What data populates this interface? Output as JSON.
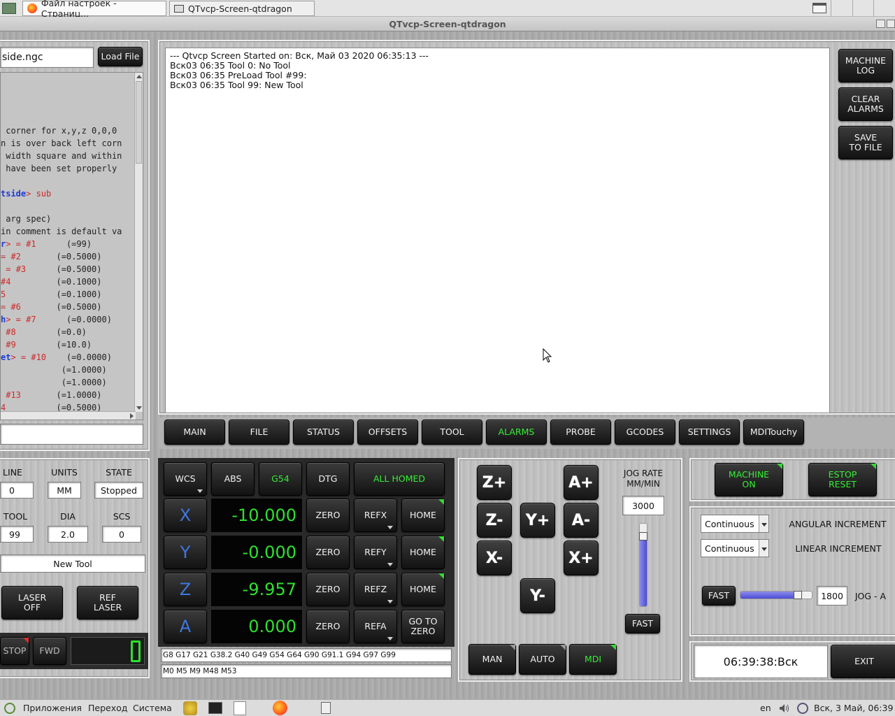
{
  "os": {
    "tabs": [
      {
        "label": "Файл настроек - Страниц..."
      },
      {
        "label": "QTvcp-Screen-qtdragon"
      }
    ],
    "window_title": "QTvcp-Screen-qtdragon"
  },
  "file_panel": {
    "filename": "side.ngc",
    "load_button": "Load File",
    "code_lines": [
      {
        "plain": ""
      },
      {
        "plain": ""
      },
      {
        "plain": ""
      },
      {
        "plain": ""
      },
      {
        "plain": " corner for x,y,z 0,0,0"
      },
      {
        "plain": "n is over back left corn"
      },
      {
        "plain": " width square and within"
      },
      {
        "plain": " have been set properly"
      },
      {
        "plain": ""
      },
      {
        "kw": "tside",
        "rest": "> sub",
        "restkw": "sub"
      },
      {
        "plain": ""
      },
      {
        "plain": " arg spec)"
      },
      {
        "plain": "in comment is default va"
      },
      {
        "kw": "r",
        "eq": "> = ",
        "red": "#1",
        "val": "      (=99)"
      },
      {
        "eq": "= ",
        "red": "#2",
        "val": "       (=0.5000)"
      },
      {
        "eq": " = ",
        "red": "#3",
        "val": "      (=0.5000)"
      },
      {
        "red": "#4",
        "val": "         (=0.1000)"
      },
      {
        "red": "5",
        "val": "          (=0.1000)"
      },
      {
        "eq": "= ",
        "red": "#6",
        "val": "       (=0.5000)"
      },
      {
        "kw": "h",
        "eq": "> = ",
        "red": "#7",
        "val": "      (=0.0000)"
      },
      {
        "eq": " ",
        "red": "#8",
        "val": "        (=0.0)"
      },
      {
        "eq": " ",
        "red": "#9",
        "val": "        (=10.0)"
      },
      {
        "kw": "et",
        "eq": "> = ",
        "red": "#10",
        "val": "    (=0.0000)"
      },
      {
        "val": "            (=1.0000)"
      },
      {
        "val": "            (=1.0000)"
      },
      {
        "eq": " ",
        "red": "#13",
        "val": "       (=1.0000)"
      },
      {
        "red": "4",
        "val": "          (=0.5000)"
      }
    ]
  },
  "log": {
    "lines": [
      "--- Qtvcp Screen Started on: Вск, Май 03 2020 06:35:13 ---",
      "Вск03 06:35 Tool 0: No Tool",
      "Вск03 06:35 PreLoad Tool #99:",
      "Вск03 06:35 Tool 99: New Tool"
    ],
    "buttons": [
      "MACHINE\nLOG",
      "CLEAR\nALARMS",
      "SAVE\nTO FILE"
    ]
  },
  "tabs": [
    {
      "label": "MAIN",
      "active": false
    },
    {
      "label": "FILE",
      "active": false
    },
    {
      "label": "STATUS",
      "active": false
    },
    {
      "label": "OFFSETS",
      "active": false
    },
    {
      "label": "TOOL",
      "active": false
    },
    {
      "label": "ALARMS",
      "active": true
    },
    {
      "label": "PROBE",
      "active": false
    },
    {
      "label": "GCODES",
      "active": false
    },
    {
      "label": "SETTINGS",
      "active": false
    },
    {
      "label": "MDITouchy",
      "active": false
    }
  ],
  "status": {
    "line_label": "LINE",
    "line_value": "0",
    "units_label": "UNITS",
    "units_value": "MM",
    "state_label": "STATE",
    "state_value": "Stopped",
    "tool_label": "TOOL",
    "tool_value": "99",
    "dia_label": "DIA",
    "dia_value": "2.0",
    "scs_label": "SCS",
    "scs_value": "0",
    "tool_description": "New Tool",
    "laser_off": "LASER\nOFF",
    "ref_laser": "REF\nLASER",
    "stop": "STOP",
    "fwd": "FWD"
  },
  "dro": {
    "wcs": "WCS",
    "abs": "ABS",
    "g54": "G54",
    "dtg": "DTG",
    "all_homed": "ALL HOMED",
    "axes": [
      {
        "name": "X",
        "value": "-10.000",
        "ref": "REFX",
        "home": "HOME"
      },
      {
        "name": "Y",
        "value": "-0.000",
        "ref": "REFY",
        "home": "HOME"
      },
      {
        "name": "Z",
        "value": "-9.957",
        "ref": "REFZ",
        "home": "HOME"
      },
      {
        "name": "A",
        "value": "0.000",
        "ref": "REFA",
        "home": "GO TO\nZERO"
      }
    ],
    "zero": "ZERO",
    "gcodes": "G8 G17 G21 G38.2 G40 G49 G54 G64 G90 G91.1 G94 G97 G99",
    "mcodes": "M0 M5 M9 M48 M53"
  },
  "jog": {
    "rate_label": "JOG RATE\nMM/MIN",
    "rate_value": "3000",
    "rate_level": 0.85,
    "fast": "FAST",
    "modes": [
      "MAN",
      "AUTO",
      "MDI"
    ],
    "keys": {
      "zp": "Z+",
      "zm": "Z-",
      "ap": "A+",
      "am": "A-",
      "yp": "Y+",
      "ym": "Y-",
      "xm": "X-",
      "xp": "X+"
    }
  },
  "right": {
    "machine_on": "MACHINE\nON",
    "estop_reset": "ESTOP\nRESET",
    "angular_select": "Continuous",
    "angular_label": "ANGULAR INCREMENT",
    "linear_select": "Continuous",
    "linear_label": "LINEAR INCREMENT",
    "fast": "FAST",
    "jog_a_value": "1800",
    "jog_a_label": "JOG - A",
    "jog_a_level": 0.8,
    "clock": "06:39:38:Вск",
    "exit": "EXIT"
  },
  "taskbar": {
    "apps": "Приложения",
    "go": "Переход",
    "system": "Система",
    "lang": "en",
    "datetime": "Вск,  3 Май, 06:39"
  }
}
